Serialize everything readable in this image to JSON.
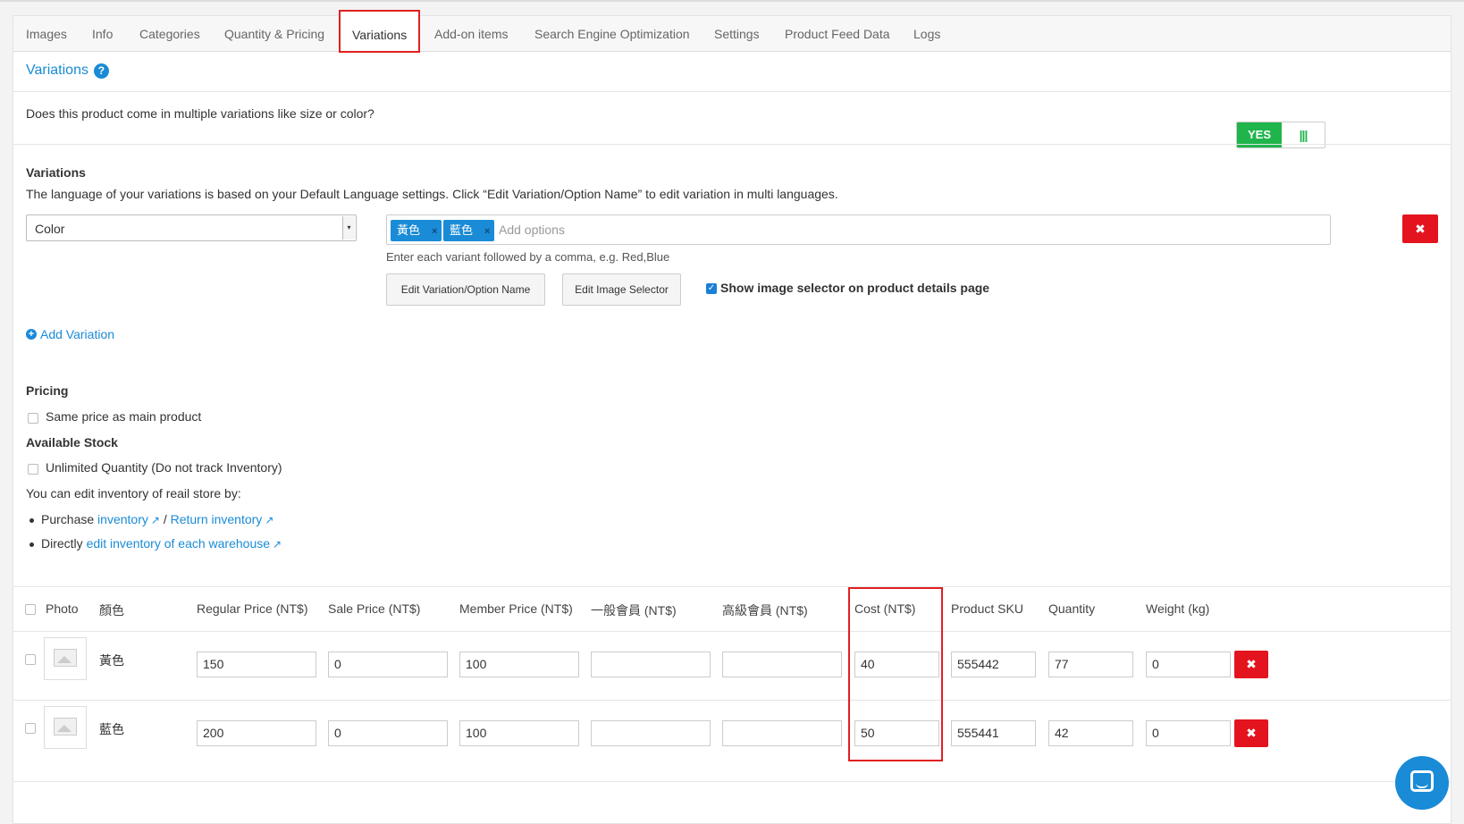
{
  "tabs": [
    {
      "label": "Images"
    },
    {
      "label": "Info"
    },
    {
      "label": "Categories"
    },
    {
      "label": "Quantity & Pricing"
    },
    {
      "label": "Variations"
    },
    {
      "label": "Add-on items"
    },
    {
      "label": "Search Engine Optimization"
    },
    {
      "label": "Settings"
    },
    {
      "label": "Product Feed Data"
    },
    {
      "label": "Logs"
    }
  ],
  "active_tab": "Variations",
  "section": {
    "title": "Variations",
    "help_icon": "?"
  },
  "multi": {
    "question": "Does this product come in multiple variations like size or color?",
    "toggle_yes": "YES",
    "toggle_grip": "|||"
  },
  "variations": {
    "heading": "Variations",
    "description": "The language of your variations is based on your Default Language settings. Click “Edit Variation/Option Name” to edit variation in multi languages.",
    "type_select": "Color",
    "tags": [
      {
        "label": "黃色"
      },
      {
        "label": "藍色"
      }
    ],
    "tag_remove": "×",
    "add_options_placeholder": "Add options",
    "hint": "Enter each variant followed by a comma, e.g. Red,Blue",
    "edit_name_button": "Edit Variation/Option Name",
    "edit_image_button": "Edit Image Selector",
    "show_image_selector_label": "Show image selector on product details page",
    "show_image_selector_checked": true,
    "add_variation": "Add Variation"
  },
  "pricing": {
    "heading": "Pricing",
    "same_price_label": "Same price as main product",
    "stock_heading": "Available Stock",
    "unlimited_label": "Unlimited Quantity (Do not track Inventory)",
    "retail_text": "You can edit inventory of reail store by:",
    "bullet1_prefix": "Purchase",
    "bullet1_link1": "inventory",
    "bullet1_sep": "/",
    "bullet1_link2": "Return inventory",
    "bullet2_prefix": "Directly",
    "bullet2_link": "edit inventory of each warehouse"
  },
  "table": {
    "headers": {
      "photo": "Photo",
      "variant": "顏色",
      "regular": "Regular Price (NT$)",
      "sale": "Sale Price (NT$)",
      "member": "Member Price (NT$)",
      "general": "一般會員 (NT$)",
      "premium": "高級會員 (NT$)",
      "cost": "Cost (NT$)",
      "sku": "Product SKU",
      "quantity": "Quantity",
      "weight": "Weight (kg)"
    },
    "rows": [
      {
        "variant": "黃色",
        "regular": "150",
        "sale": "0",
        "member": "100",
        "general": "",
        "premium": "",
        "cost": "40",
        "sku": "555442",
        "quantity": "77",
        "weight": "0"
      },
      {
        "variant": "藍色",
        "regular": "200",
        "sale": "0",
        "member": "100",
        "general": "",
        "premium": "",
        "cost": "50",
        "sku": "555441",
        "quantity": "42",
        "weight": "0"
      }
    ]
  },
  "delete_symbol": "✖",
  "colors": {
    "accent": "#1a8bd6",
    "danger": "#e3141e",
    "toggle_on": "#1fb54b",
    "highlight": "#e02020"
  }
}
